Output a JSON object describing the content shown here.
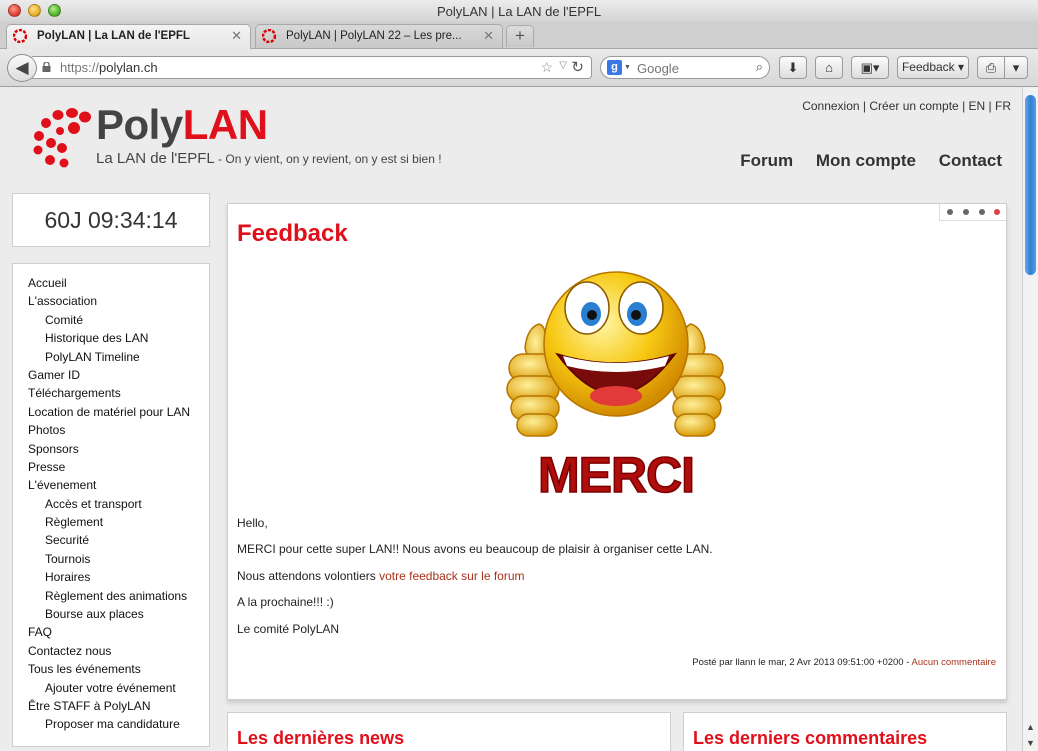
{
  "window": {
    "title": "PolyLAN | La LAN de l'EPFL",
    "tabs": [
      {
        "label": "PolyLAN | La LAN de l'EPFL",
        "active": true
      },
      {
        "label": "PolyLAN | PolyLAN 22 – Les pre...",
        "active": false
      }
    ],
    "new_tab": "+"
  },
  "toolbar": {
    "url_scheme": "https://",
    "url_host": "polylan.ch",
    "search_placeholder": "Google",
    "feedback_label": "Feedback"
  },
  "site": {
    "brand_poly": "Poly",
    "brand_lan": "LAN",
    "tagline": "La LAN de l'EPFL",
    "tagline_small": " - On y vient, on y revient, on y est si bien !",
    "top_links": [
      "Connexion",
      "Créer un compte",
      "EN",
      "FR"
    ],
    "nav": [
      "Forum",
      "Mon compte",
      "Contact"
    ],
    "countdown": "60J 09:34:14"
  },
  "sidebar": {
    "items": [
      {
        "label": "Accueil",
        "level": 0
      },
      {
        "label": "L'association",
        "level": 0
      },
      {
        "label": "Comité",
        "level": 1
      },
      {
        "label": "Historique des LAN",
        "level": 1
      },
      {
        "label": "PolyLAN Timeline",
        "level": 1
      },
      {
        "label": "Gamer ID",
        "level": 0
      },
      {
        "label": "Téléchargements",
        "level": 0
      },
      {
        "label": "Location de matériel pour LAN",
        "level": 0
      },
      {
        "label": "Photos",
        "level": 0
      },
      {
        "label": "Sponsors",
        "level": 0
      },
      {
        "label": "Presse",
        "level": 0
      },
      {
        "label": "L'évenement",
        "level": 0
      },
      {
        "label": "Accès et transport",
        "level": 1
      },
      {
        "label": "Règlement",
        "level": 1
      },
      {
        "label": "Securité",
        "level": 1
      },
      {
        "label": "Tournois",
        "level": 1
      },
      {
        "label": "Horaires",
        "level": 1
      },
      {
        "label": "Règlement des animations",
        "level": 1
      },
      {
        "label": "Bourse aux places",
        "level": 1
      },
      {
        "label": "FAQ",
        "level": 0
      },
      {
        "label": "Contactez nous",
        "level": 0
      },
      {
        "label": "Tous les événements",
        "level": 0
      },
      {
        "label": "Ajouter votre événement",
        "level": 1
      },
      {
        "label": "Être STAFF à PolyLAN",
        "level": 0
      },
      {
        "label": "Proposer ma candidature",
        "level": 1
      }
    ]
  },
  "article": {
    "title": "Feedback",
    "image_text": "MERCI",
    "greeting": "Hello,",
    "line1": "MERCI pour cette super LAN!! Nous avons eu beaucoup de plaisir à organiser cette LAN.",
    "line2_prefix": "Nous attendons volontiers ",
    "line2_link": "votre feedback sur le forum",
    "line3": "A la prochaine!!! :)",
    "signature": "Le comité PolyLAN",
    "posted": "Posté par llann le mar, 2 Avr 2013 09:51:00 +0200 - ",
    "comments_link": "Aucun commentaire"
  },
  "bottom": {
    "news_title": "Les dernières news",
    "comments_title": "Les derniers commentaires"
  },
  "colors": {
    "brand_red": "#e0101b",
    "link": "#a8331b",
    "text": "#333333"
  }
}
